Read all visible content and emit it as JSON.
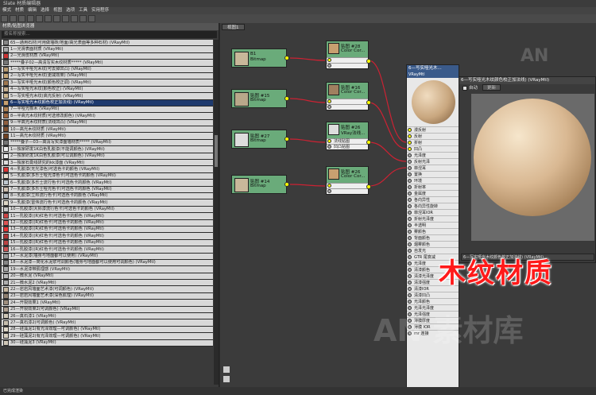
{
  "window": {
    "title": "Slate 材质编辑器"
  },
  "menu": [
    "模式",
    "材质",
    "编辑",
    "选择",
    "视图",
    "选项",
    "工具",
    "实用程序"
  ],
  "browser": {
    "title": "材质/贴图浏览器",
    "search_placeholder": "按名称搜索...",
    "items": [
      {
        "label": "65—通用石材(可用做墙砖/地面/高光表面等多种石材)   (VRayMtl)",
        "color": "#888",
        "selected": false
      },
      {
        "label": "1—光滑表面材质   (VRayMtl)",
        "color": "#aaa",
        "selected": false
      },
      {
        "label": "2—光滑皮材质   (VRayMtl)",
        "color": "#c33",
        "selected": false
      },
      {
        "label": "*****叠子02—高清写实木纹材质*****   (VRayMtl)",
        "color": "#777",
        "selected": false
      },
      {
        "label": "1—写实半哑光木纹(可去掉凹凸)   (VRayMtl)",
        "color": "#b89a70",
        "selected": false
      },
      {
        "label": "2—写实半哑光木纹(更减效果)   (VRayMtl)",
        "color": "#c8a878",
        "selected": false
      },
      {
        "label": "3—写实半哑光木纹(颜色校正调)   (VRayMtl)",
        "color": "#a07850",
        "selected": false
      },
      {
        "label": "4—写实哑光木纹(颜色校正)   (VRayMtl)",
        "color": "#c8b090",
        "selected": false
      },
      {
        "label": "5—写实哑光木纹(高光反射)   (VRayMtl)",
        "color": "#d0b890",
        "selected": false
      },
      {
        "label": "6—写实哑光木纹颜色校正加法线)   (VRayMtl)",
        "color": "#c8a070",
        "selected": true
      },
      {
        "label": "7—半哑光橡木   (VRayMtl)",
        "color": "#b08050",
        "selected": false
      },
      {
        "label": "8—半高光木纹材质(可选修改颜色)   (VRayMtl)",
        "color": "#a06840",
        "selected": false
      },
      {
        "label": "9—半高光木纹材质(法线凹凸)   (VRayMtl)",
        "color": "#906040",
        "selected": false
      },
      {
        "label": "10—高光木纹材质   (VRayMtl)",
        "color": "#805030",
        "selected": false
      },
      {
        "label": "11—高光木纹材质   (VRayMtl)",
        "color": "#704020",
        "selected": false
      },
      {
        "label": "*****叠子—03—高清写实漆面墙材质*****   (VRayMtl)",
        "color": "#777",
        "selected": false
      },
      {
        "label": "1—独家研发1K白色乳胶漆(不能调颜色)   (VRayMtl)",
        "color": "#f0f0f0",
        "selected": false
      },
      {
        "label": "2—独家研发1K白色乳胶漆(可以调颜色)   (VRayMtl)",
        "color": "#eee",
        "selected": false
      },
      {
        "label": "3—独家石膏线研究的kk漆面   (VRayMtl)",
        "color": "#ddd",
        "selected": false
      },
      {
        "label": "4—乳胶漆(无光漆色)可选色卡的颜色   (VRayMtl)",
        "color": "#d33",
        "selected": false
      },
      {
        "label": "5—乳胶漆(多乐士哑光漆色卡)可选色卡的颜色   (VRayMtl)",
        "color": "#e8e0d0",
        "selected": false
      },
      {
        "label": "6—乳胶漆(多乐士流行色卡)可选色卡的颜色   (VRayMtl)",
        "color": "#c0c8d0",
        "selected": false
      },
      {
        "label": "7—乳胶漆(多乐士哑光色卡)可选色卡的颜色   (VRayMtl)",
        "color": "#d0c0b0",
        "selected": false
      },
      {
        "label": "8—乳胶漆(立邦流行色卡)可选色卡的颜色   (VRayMtl)",
        "color": "#b0b8c0",
        "selected": false
      },
      {
        "label": "9—乳胶漆(雷伟流行色卡)可选色卡的颜色   (VRayMtl)",
        "color": "#e0d8c8",
        "selected": false
      },
      {
        "label": "10—乳胶漆(大师漆流行色卡)可选色卡的颜色   (VRayMtl)",
        "color": "#c8c8c8",
        "selected": false
      },
      {
        "label": "11—乳胶漆((R)红色卡)可选色卡的颜色   (VRayMtl)",
        "color": "#c44",
        "selected": false
      },
      {
        "label": "12—乳胶漆((R)红色卡)可选色卡的颜色   (VRayMtl)",
        "color": "#d55",
        "selected": false
      },
      {
        "label": "13—乳胶漆((R)红色卡)可选色卡的颜色   (VRayMtl)",
        "color": "#e33",
        "selected": false
      },
      {
        "label": "14—乳胶漆((R)红色卡)可选色卡的颜色   (VRayMtl)",
        "color": "#a33",
        "selected": false
      },
      {
        "label": "15—乳胶漆((R)红色卡)可选色卡的颜色   (VRayMtl)",
        "color": "#b44",
        "selected": false
      },
      {
        "label": "16—乳胶漆((R)红色卡)可选色卡的颜色   (VRayMtl)",
        "color": "#c55",
        "selected": false
      },
      {
        "label": "17—水泥漆(墙身与地面都可以使用)   (VRayMtl)",
        "color": "#999",
        "selected": false
      },
      {
        "label": "18—水泥漆—简化水泥浆可调颜色(墙身与地面都可以使用可调颜色)   (VRayMtl)",
        "color": "#888",
        "selected": false
      },
      {
        "label": "19—水泥漆带肌理感   (VRayMtl)",
        "color": "#aaa",
        "selected": false
      },
      {
        "label": "20—微水泥   (VRayMtl)",
        "color": "#bbb",
        "selected": false
      },
      {
        "label": "21—微水泥2   (VRayMtl)",
        "color": "#b0b0b0",
        "selected": false
      },
      {
        "label": "22—岩岩风墙面艺术漆(可调颜色)   (VRayMtl)",
        "color": "#c8b8a0",
        "selected": false
      },
      {
        "label": "23—岩岩风墙面艺术漆(深色肌理)   (VRayMtl)",
        "color": "#908070",
        "selected": false
      },
      {
        "label": "24—开裂效果1   (VRayMtl)",
        "color": "#a09080",
        "selected": false
      },
      {
        "label": "25—开裂效果2(可调颜色)   (VRayMtl)",
        "color": "#b0a090",
        "selected": false
      },
      {
        "label": "26—真石漆1   (VRayMtl)",
        "color": "#d0c8b8",
        "selected": false
      },
      {
        "label": "27—真石漆2(可调颜色)   (VRayMtl)",
        "color": "#c8c0b0",
        "selected": false
      },
      {
        "label": "28—硅藻泥1(有光泽效理—可调颜色)   (VRayMtl)",
        "color": "#e0d8c8",
        "selected": false
      },
      {
        "label": "29—硅藻泥2(有光泽效理—可调颜色)   (VRayMtl)",
        "color": "#d8d0c0",
        "selected": false
      },
      {
        "label": "30—硅藻泥3   (VRayMtl)",
        "color": "#d0c8b8",
        "selected": false
      }
    ]
  },
  "view": {
    "tab": "视图1"
  },
  "nodes": {
    "b1": {
      "label": "B1",
      "type": "Bitmap"
    },
    "b15": {
      "label": "贴图 #15",
      "type": "Bitmap"
    },
    "b27": {
      "label": "贴图 #27",
      "type": "Bitmap"
    },
    "b14": {
      "label": "贴图 #14",
      "type": "Bitmap"
    },
    "c28": {
      "label": "贴图 #28",
      "type": "Color Cor..."
    },
    "c16": {
      "label": "贴图 #16",
      "type": "Color Cor..."
    },
    "c26": {
      "label": "贴图 #26",
      "type": "VRay法线...",
      "slots": [
        "法线贴图",
        "凹凸贴图"
      ]
    },
    "c26b": {
      "label": "贴图 #26",
      "type": "Color Cor..."
    }
  },
  "vray": {
    "title": "6—写实哑光木...",
    "type": "VRayMtl",
    "slots": [
      "漫反射",
      "反射",
      "折射",
      "凹凸",
      "光泽度",
      "反射光泽",
      "菲涅耳",
      "置换",
      "环境",
      "折射率",
      "金属度",
      "各向异性",
      "各向异性旋转",
      "菲涅耳IOR",
      "折射光泽度",
      "半透明",
      "雾颜色",
      "背面颜色",
      "烟雾颜色",
      "自发光",
      "GTR 尾衰减",
      "光泽度",
      "清漆颜色",
      "清漆光泽度",
      "清漆强度",
      "清漆IOR",
      "清漆凹凸",
      "光泽颜色",
      "光泽光泽度",
      "光泽强度",
      "薄膜厚度",
      "薄膜 IOR",
      "mr 连接"
    ]
  },
  "props": {
    "title": "6—写实哑光木纹颜色校正加法线)   (VRayMtl)",
    "auto_label": "自动",
    "update_label": "更新",
    "footer": "6—写实哑光木纹颜色校正加法线)   (VRayMtl)"
  },
  "overlay": {
    "big_title": "木纹材质",
    "watermark1": "AN",
    "watermark2": "AN 素材库"
  },
  "status": {
    "text": "已完成渲染"
  }
}
